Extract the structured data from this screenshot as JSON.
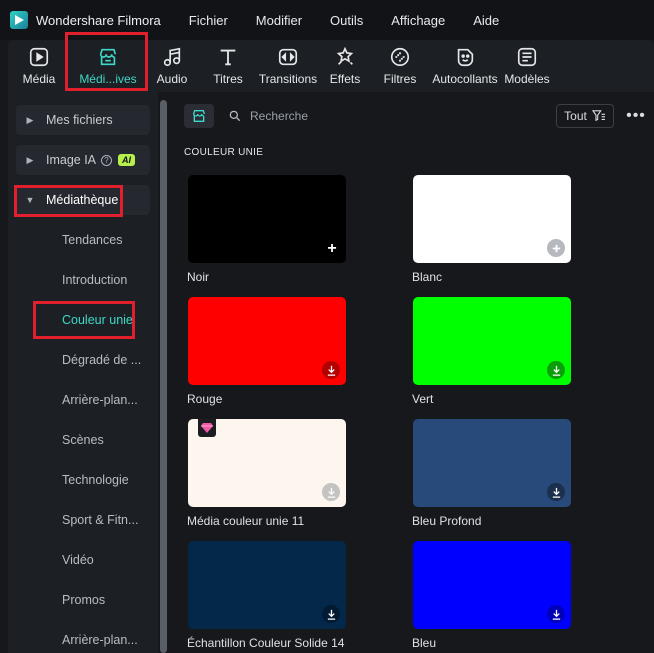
{
  "app": {
    "name": "Wondershare Filmora"
  },
  "menu": [
    "Fichier",
    "Modifier",
    "Outils",
    "Affichage",
    "Aide"
  ],
  "toolbar": [
    {
      "label": "Média",
      "icon": "media-icon"
    },
    {
      "label": "Médi...ives",
      "icon": "store-icon",
      "active": true
    },
    {
      "label": "Audio",
      "icon": "music-note-icon"
    },
    {
      "label": "Titres",
      "icon": "text-t-icon"
    },
    {
      "label": "Transitions",
      "icon": "transitions-icon"
    },
    {
      "label": "Effets",
      "icon": "effects-icon"
    },
    {
      "label": "Filtres",
      "icon": "filters-icon"
    },
    {
      "label": "Autocollants",
      "icon": "sticker-icon"
    },
    {
      "label": "Modèles",
      "icon": "templates-icon"
    }
  ],
  "sidebar": {
    "mes_fichiers": "Mes fichiers",
    "image_ia": "Image IA",
    "ai_badge": "AI",
    "mediatheque": "Médiathèque",
    "items": [
      "Tendances",
      "Introduction",
      "Couleur unie",
      "Dégradé de ...",
      "Arrière-plan...",
      "Scènes",
      "Technologie",
      "Sport & Fitn...",
      "Vidéo",
      "Promos",
      "Arrière-plan..."
    ]
  },
  "main": {
    "search_placeholder": "Recherche",
    "filter_label": "Tout",
    "more": "•••",
    "section_title": "COULEUR UNIE",
    "cards": [
      {
        "label": "Noir",
        "color": "#000000",
        "badge": "add"
      },
      {
        "label": "Blanc",
        "color": "#ffffff",
        "badge": "add-grey"
      },
      {
        "label": "Rouge",
        "color": "#ff0000",
        "badge": "download"
      },
      {
        "label": "Vert",
        "color": "#00ff00",
        "badge": "download"
      },
      {
        "label": "Média couleur unie 11",
        "color": "#fdf6ee",
        "badge": "download-grey",
        "premium": true
      },
      {
        "label": "Bleu Profond",
        "color": "#274a7a",
        "badge": "download"
      },
      {
        "label": "Échantillon Couleur Solide 14",
        "color": "#03284a",
        "badge": "download"
      },
      {
        "label": "Bleu",
        "color": "#0000ff",
        "badge": "download"
      }
    ]
  },
  "colors": {
    "accent": "#3fd9c7",
    "highlight": "#e11f2d"
  }
}
